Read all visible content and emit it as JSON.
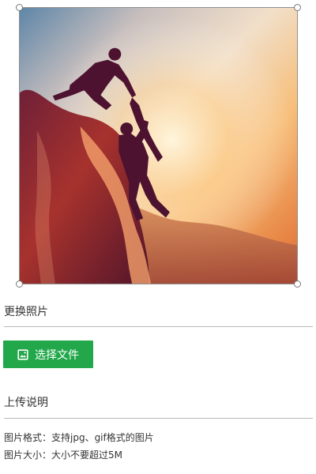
{
  "image_editor": {
    "photo_icon": "mountain-climbers-photo",
    "handle_color": "#777777"
  },
  "change_photo": {
    "title": "更换照片"
  },
  "file_picker": {
    "button_label": "选择文件",
    "button_icon": "image-icon",
    "button_color": "#22a84a"
  },
  "upload_info": {
    "title": "上传说明",
    "format_note": "图片格式：支持jpg、gif格式的图片",
    "size_note": "图片大小：大小不要超过5M"
  }
}
